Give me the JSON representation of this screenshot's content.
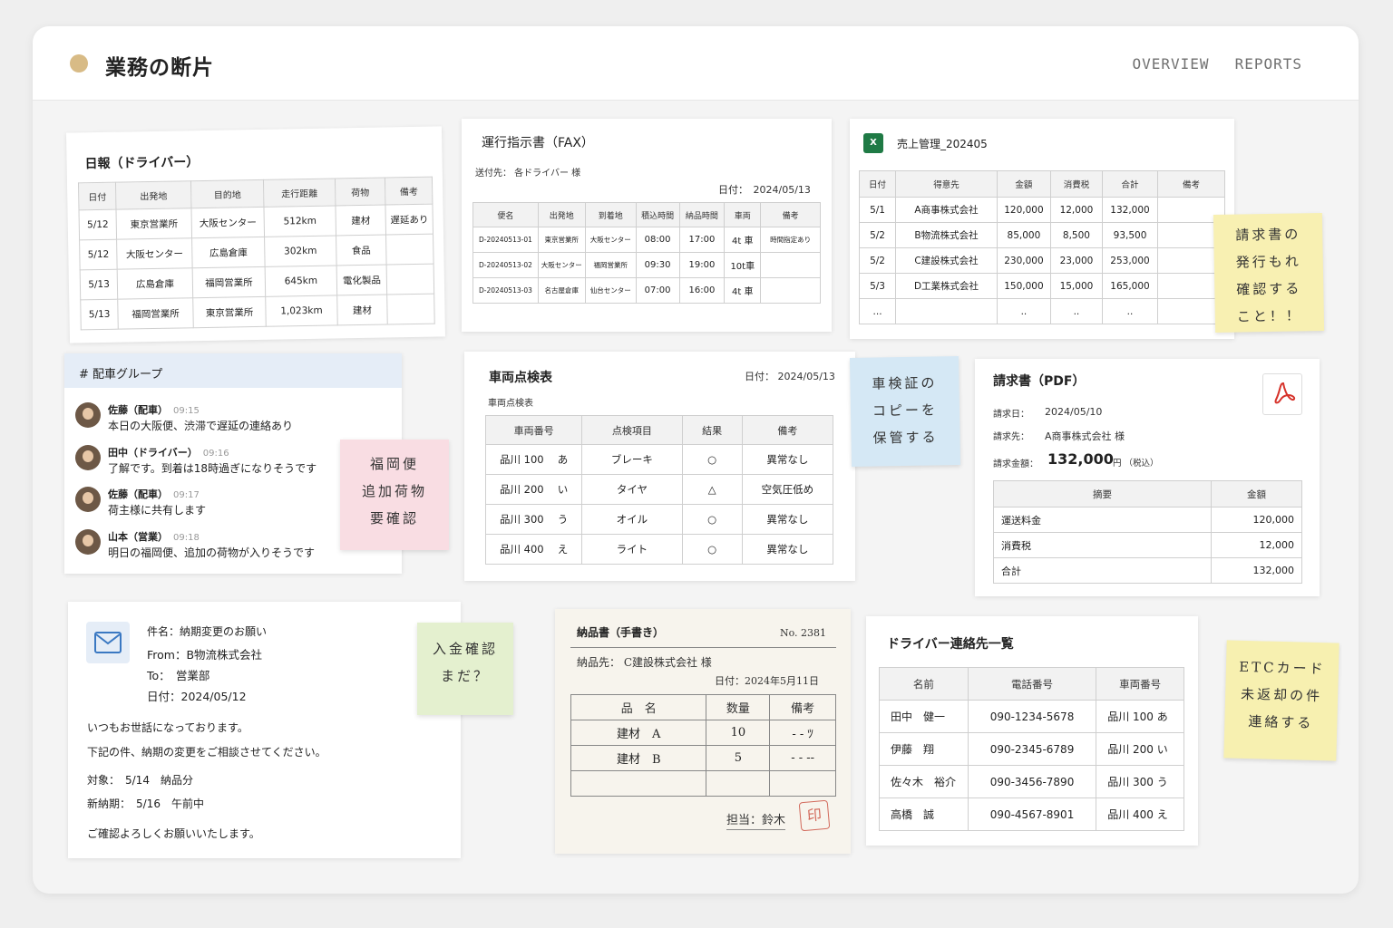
{
  "app": {
    "title": "業務の断片",
    "nav": [
      "OVERVIEW",
      "REPORTS"
    ],
    "accent": "#d8bb86"
  },
  "daily": {
    "title": "日報（ドライバー）",
    "headers": [
      "日付",
      "出発地",
      "目的地",
      "走行距離",
      "荷物",
      "備考"
    ],
    "rows": [
      [
        "5/12",
        "東京営業所",
        "大阪センター",
        "512km",
        "建材",
        "遅延あり"
      ],
      [
        "5/12",
        "大阪センター",
        "広島倉庫",
        "302km",
        "食品",
        ""
      ],
      [
        "5/13",
        "広島倉庫",
        "福岡営業所",
        "645km",
        "電化製品",
        ""
      ],
      [
        "5/13",
        "福岡営業所",
        "東京営業所",
        "1,023km",
        "建材",
        ""
      ]
    ]
  },
  "fax": {
    "title": "運行指示書（FAX）",
    "to": "送付先： 各ドライバー 様",
    "date": "日付：　2024/05/13",
    "headers": [
      "便名",
      "出発地",
      "到着地",
      "積込時間",
      "納品時間",
      "車両",
      "備考"
    ],
    "rows": [
      [
        "D-20240513-01",
        "東京営業所",
        "大阪センター",
        "08:00",
        "17:00",
        "4t 車",
        "時間指定あり"
      ],
      [
        "D-20240513-02",
        "大阪センター",
        "福岡営業所",
        "09:30",
        "19:00",
        "10t車",
        ""
      ],
      [
        "D-20240513-03",
        "名古屋倉庫",
        "仙台センター",
        "07:00",
        "16:00",
        "4t 車",
        ""
      ]
    ]
  },
  "sales": {
    "title": "売上管理_202405",
    "icon_label": "X",
    "headers": [
      "日付",
      "得意先",
      "金額",
      "消費税",
      "合計",
      "備考"
    ],
    "rows": [
      [
        "5/1",
        "A商事株式会社",
        "120,000",
        "12,000",
        "132,000",
        ""
      ],
      [
        "5/2",
        "B物流株式会社",
        "85,000",
        "8,500",
        "93,500",
        ""
      ],
      [
        "5/2",
        "C建設株式会社",
        "230,000",
        "23,000",
        "253,000",
        ""
      ],
      [
        "5/3",
        "D工業株式会社",
        "150,000",
        "15,000",
        "165,000",
        ""
      ],
      [
        "...",
        "",
        "..",
        "..",
        "..",
        ""
      ]
    ]
  },
  "chat": {
    "channel": "#  配車グループ",
    "messages": [
      {
        "name": "佐藤（配車）",
        "time": "09:15",
        "text": "本日の大阪便、渋滞で遅延の連絡あり"
      },
      {
        "name": "田中（ドライバー）",
        "time": "09:16",
        "text": "了解です。到着は18時過ぎになりそうです"
      },
      {
        "name": "佐藤（配車）",
        "time": "09:17",
        "text": "荷主様に共有します"
      },
      {
        "name": "山本（営業）",
        "time": "09:18",
        "text": "明日の福岡便、追加の荷物が入りそうです"
      }
    ]
  },
  "notes": {
    "invoice": [
      "請求書の",
      "発行もれ",
      "確認する",
      "こと！！"
    ],
    "fukuoka": [
      "福岡便",
      "追加荷物",
      "要確認"
    ],
    "shaken": [
      "車検証の",
      "コピーを",
      "保管する"
    ],
    "payment": [
      "入金確認",
      "まだ？"
    ],
    "etc": [
      "ETCカード",
      "未返却の件",
      "連絡する"
    ]
  },
  "inspect": {
    "title": "車両点検表",
    "subtitle": "車両点検表",
    "date": "日付： 2024/05/13",
    "headers": [
      "車両番号",
      "点検項目",
      "結果",
      "備考"
    ],
    "rows": [
      [
        "品川  100  　あ",
        "ブレーキ",
        "○",
        "異常なし"
      ],
      [
        "品川  200  　い",
        "タイヤ",
        "△",
        "空気圧低め"
      ],
      [
        "品川  300  　う",
        "オイル",
        "○",
        "異常なし"
      ],
      [
        "品川  400  　え",
        "ライト",
        "○",
        "異常なし"
      ]
    ]
  },
  "invoice": {
    "title": "請求書（PDF）",
    "date_label": "請求日：",
    "date": "2024/05/10",
    "to_label": "請求先：",
    "to": "A商事株式会社 様",
    "amount_label": "請求金額：",
    "amount": "132,000",
    "amount_suffix": "円 （税込）",
    "headers": [
      "摘要",
      "金額"
    ],
    "rows": [
      [
        "運送料金",
        "120,000"
      ],
      [
        "消費税",
        "12,000"
      ],
      [
        "合計",
        "132,000"
      ]
    ]
  },
  "email": {
    "subject": "件名：納期変更のお願い",
    "from": "From：B物流株式会社",
    "to": "To：　営業部",
    "date": "日付：2024/05/12",
    "body": [
      "いつもお世話になっております。",
      "下記の件、納期の変更をご相談させてください。",
      "対象：　5/14　納品分",
      "新納期：　5/16　午前中",
      "ご確認よろしくお願いいたします。"
    ]
  },
  "delivery": {
    "title": "納品書（手書き）",
    "number": "No.  2381",
    "to": "納品先： C建設株式会社 様",
    "date": "日付：2024年5月11日",
    "headers": [
      "品　名",
      "数量",
      "備考"
    ],
    "rows": [
      [
        "建材　A",
        "10",
        "- - ﾂ"
      ],
      [
        "建材　B",
        "5",
        "- - --"
      ],
      [
        "",
        "",
        ""
      ]
    ],
    "staff": "担当：鈴木"
  },
  "contacts": {
    "title": "ドライバー連絡先一覧",
    "headers": [
      "名前",
      "電話番号",
      "車両番号"
    ],
    "rows": [
      [
        "田中　健一",
        "090-1234-5678",
        "品川 100 あ"
      ],
      [
        "伊藤　翔",
        "090-2345-6789",
        "品川 200 い"
      ],
      [
        "佐々木　裕介",
        "090-3456-7890",
        "品川 300 う"
      ],
      [
        "高橋　誠",
        "090-4567-8901",
        "品川 400 え"
      ]
    ]
  }
}
